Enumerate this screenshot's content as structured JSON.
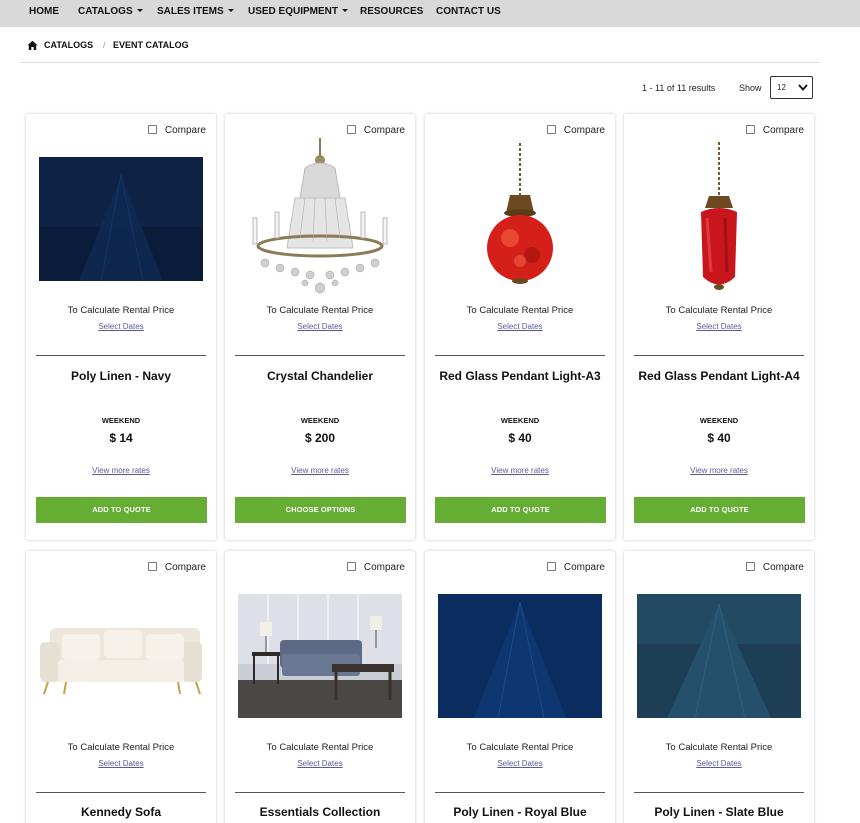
{
  "nav": {
    "items": [
      {
        "label": "HOME",
        "dropdown": false
      },
      {
        "label": "CATALOGS",
        "dropdown": true
      },
      {
        "label": "SALES ITEMS",
        "dropdown": true
      },
      {
        "label": "USED EQUIPMENT",
        "dropdown": true
      },
      {
        "label": "RESOURCES",
        "dropdown": false
      },
      {
        "label": "CONTACT US",
        "dropdown": false
      }
    ]
  },
  "breadcrumb": {
    "icon": "home-icon",
    "items": [
      "CATALOGS",
      "EVENT CATALOG"
    ],
    "separator": "/"
  },
  "toolbar": {
    "results": "1 - 11 of 11 results",
    "show_label": "Show",
    "show_value": "12"
  },
  "compare_label": "Compare",
  "rental_prompt": "To Calculate Rental Price",
  "select_dates_label": "Select Dates",
  "rate_label": "WEEKEND",
  "more_rates_label": "View more rates",
  "products": [
    {
      "name": "Poly Linen - Navy",
      "price": "$ 14",
      "button": "ADD TO QUOTE",
      "image": "navy-linen"
    },
    {
      "name": "Crystal Chandelier",
      "price": "$ 200",
      "button": "CHOOSE OPTIONS",
      "image": "chandelier"
    },
    {
      "name": "Red Glass Pendant Light-A3",
      "price": "$ 40",
      "button": "ADD TO QUOTE",
      "image": "red-pendant-round"
    },
    {
      "name": "Red Glass Pendant Light-A4",
      "price": "$ 40",
      "button": "ADD TO QUOTE",
      "image": "red-pendant-tall"
    },
    {
      "name": "Kennedy Sofa",
      "image": "sofa"
    },
    {
      "name": "Essentials Collection",
      "image": "living-room"
    },
    {
      "name": "Poly Linen - Royal Blue",
      "image": "royal-blue-linen"
    },
    {
      "name": "Poly Linen - Slate Blue",
      "image": "slate-blue-linen"
    }
  ],
  "colors": {
    "nav_bg": "#d9d9d9",
    "button_green": "#66ad33",
    "link": "#5b5b9a"
  }
}
